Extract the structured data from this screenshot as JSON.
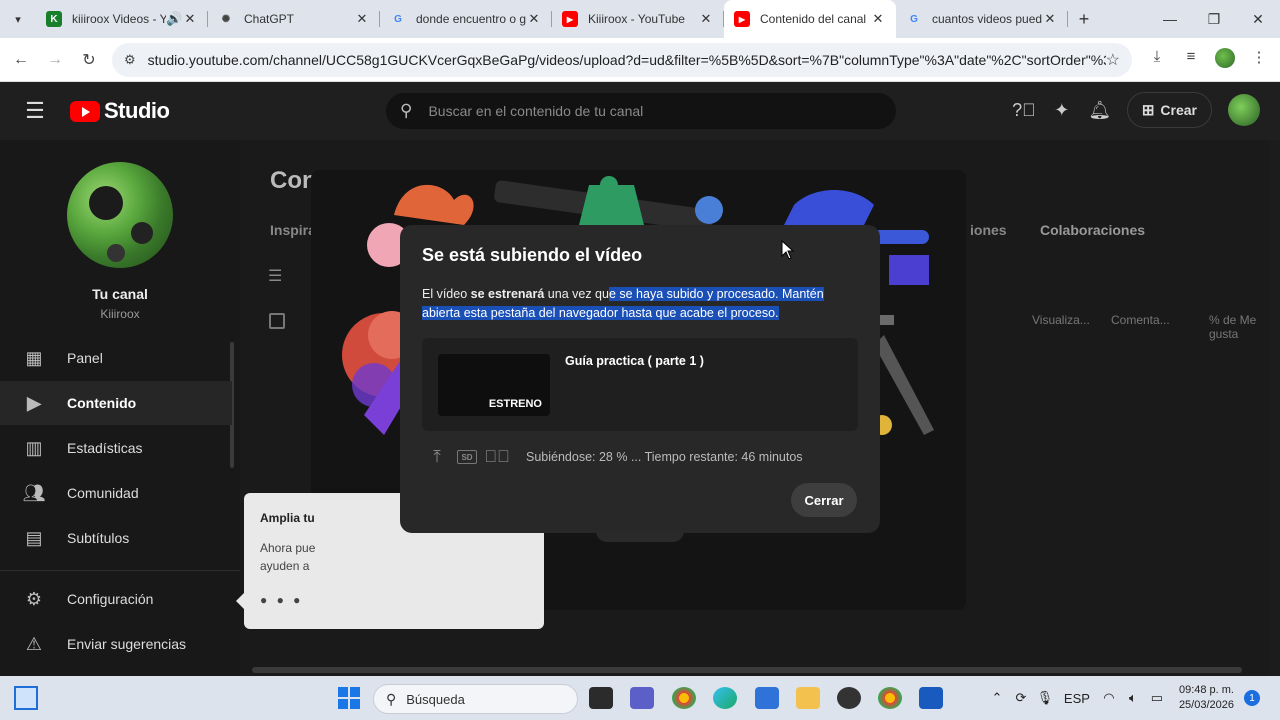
{
  "browser": {
    "tabs": [
      {
        "title": "kiiiroox Videos - Y",
        "favicon": "k-icon",
        "active": false
      },
      {
        "title": "ChatGPT",
        "favicon": "chatgpt-icon",
        "active": false
      },
      {
        "title": "donde encuentro o g",
        "favicon": "google-icon",
        "active": false
      },
      {
        "title": "Kiiiroox - YouTube",
        "favicon": "youtube-icon",
        "active": false
      },
      {
        "title": "Contenido del canal",
        "favicon": "youtube-icon",
        "active": true
      },
      {
        "title": "cuantos videos pued",
        "favicon": "google-icon",
        "active": false
      }
    ],
    "url": "studio.youtube.com/channel/UCC58g1GUCKVcerGqxBeGaPg/videos/upload?d=ud&filter=%5B%5D&sort=%7B\"columnType\"%3A\"date\"%2C\"sortOrder\"%3A\"DES..."
  },
  "studio": {
    "logo_label": "Studio",
    "search_placeholder": "Buscar en el contenido de tu canal",
    "create_label": "Crear"
  },
  "sidebar": {
    "channel_name": "Tu canal",
    "channel_handle": "Kiiiroox",
    "items": [
      {
        "label": "Panel",
        "icon": "dashboard-icon"
      },
      {
        "label": "Contenido",
        "icon": "content-icon",
        "selected": true
      },
      {
        "label": "Estadísticas",
        "icon": "analytics-icon"
      },
      {
        "label": "Comunidad",
        "icon": "community-icon"
      },
      {
        "label": "Subtítulos",
        "icon": "subtitles-icon"
      },
      {
        "label": "Configuración",
        "icon": "settings-icon"
      },
      {
        "label": "Enviar sugerencias",
        "icon": "feedback-icon"
      }
    ]
  },
  "content": {
    "title_partial": "Con",
    "tab_partial": "Inspira",
    "tab_partial_right": "iones",
    "tab_colab": "Colaboraciones",
    "columns": [
      "Visualiza...",
      "Comenta...",
      "% de Me gusta"
    ],
    "promo_title": "Amplia tu",
    "promo_body_1": "Ahora pue",
    "promo_body_2": "ayuden a"
  },
  "dialog": {
    "title": "Se está subiendo el vídeo",
    "msg_part1": "El vídeo ",
    "msg_bold": "se estrenará",
    "msg_part2": " una vez qu",
    "msg_highlight": "e se haya subido y procesado. Mantén abierta esta pestaña del navegador hasta que acabe el proceso.",
    "video_title": "Guía practica ( parte 1 )",
    "badge": "ESTRENO",
    "sd_label": "SD",
    "status": "Subiéndose: 28 % ... Tiempo restante: 46 minutos",
    "upload_progress": 28,
    "close_label": "Cerrar"
  },
  "taskbar": {
    "search_label": "Búsqueda",
    "language": "ESP",
    "time": "09:48 p. m.",
    "date": "25/03/2026",
    "notifications": "1"
  }
}
